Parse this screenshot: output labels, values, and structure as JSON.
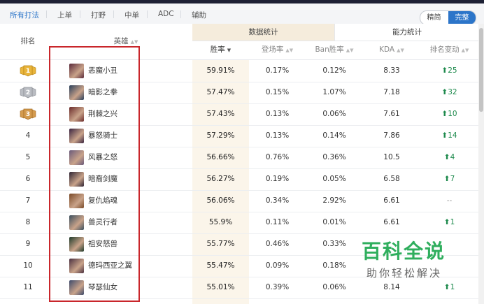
{
  "filters": [
    "所有打法",
    "上单",
    "打野",
    "中单",
    "ADC",
    "辅助"
  ],
  "view_toggle": {
    "options": [
      "精简",
      "完整"
    ],
    "selected": "完整"
  },
  "table": {
    "col_rank": "排名",
    "col_hero": "英雄",
    "group_data": "数据统计",
    "group_ability": "能力统计",
    "col_winrate": "胜率",
    "col_pickrate": "登场率",
    "col_banrate": "Ban胜率",
    "col_kda": "KDA",
    "col_change": "排名变动"
  },
  "rows": [
    {
      "rank": "1",
      "medal": "gold",
      "name": "恶魔小丑",
      "win": "59.91%",
      "pick": "0.17%",
      "ban": "0.12%",
      "kda": "8.33",
      "change": "25",
      "dir": "up"
    },
    {
      "rank": "2",
      "medal": "silver",
      "name": "暗影之拳",
      "win": "57.47%",
      "pick": "0.15%",
      "ban": "1.07%",
      "kda": "7.18",
      "change": "32",
      "dir": "up"
    },
    {
      "rank": "3",
      "medal": "bronze",
      "name": "荆棘之兴",
      "win": "57.43%",
      "pick": "0.13%",
      "ban": "0.06%",
      "kda": "7.61",
      "change": "10",
      "dir": "up"
    },
    {
      "rank": "4",
      "medal": "",
      "name": "暴怒骑士",
      "win": "57.29%",
      "pick": "0.13%",
      "ban": "0.14%",
      "kda": "7.86",
      "change": "14",
      "dir": "up"
    },
    {
      "rank": "5",
      "medal": "",
      "name": "风暴之怒",
      "win": "56.66%",
      "pick": "0.76%",
      "ban": "0.36%",
      "kda": "10.5",
      "change": "4",
      "dir": "up"
    },
    {
      "rank": "6",
      "medal": "",
      "name": "暗裔剑魔",
      "win": "56.27%",
      "pick": "0.19%",
      "ban": "0.05%",
      "kda": "6.58",
      "change": "7",
      "dir": "up"
    },
    {
      "rank": "7",
      "medal": "",
      "name": "复仇焰魂",
      "win": "56.06%",
      "pick": "0.34%",
      "ban": "2.92%",
      "kda": "6.61",
      "change": "--",
      "dir": "none"
    },
    {
      "rank": "8",
      "medal": "",
      "name": "兽灵行者",
      "win": "55.9%",
      "pick": "0.11%",
      "ban": "0.01%",
      "kda": "6.61",
      "change": "1",
      "dir": "up"
    },
    {
      "rank": "9",
      "medal": "",
      "name": "祖安怒兽",
      "win": "55.77%",
      "pick": "0.46%",
      "ban": "0.33%",
      "kda": "",
      "change": "",
      "dir": "none"
    },
    {
      "rank": "10",
      "medal": "",
      "name": "德玛西亚之翼",
      "win": "55.47%",
      "pick": "0.09%",
      "ban": "0.18%",
      "kda": "",
      "change": "",
      "dir": "none"
    },
    {
      "rank": "11",
      "medal": "",
      "name": "琴瑟仙女",
      "win": "55.01%",
      "pick": "0.39%",
      "ban": "0.06%",
      "kda": "8.14",
      "change": "1",
      "dir": "up"
    }
  ],
  "watermark": {
    "title": "百科全说",
    "subtitle": "助你轻松解决"
  },
  "colors": {
    "accent": "#2c75c9",
    "up": "#1e8a4d",
    "highlight_box": "#c9262b",
    "win_column_bg": "#fbf5ea",
    "watermark": "#2fae5d"
  }
}
